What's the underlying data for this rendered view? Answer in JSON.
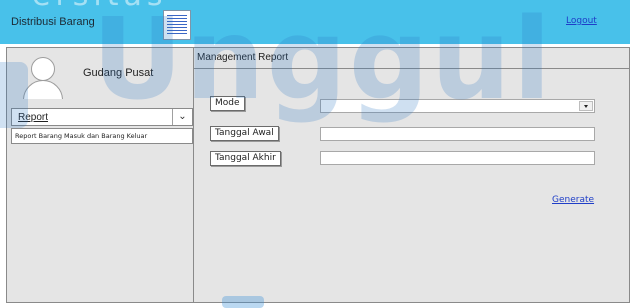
{
  "header": {
    "app_title": "Distribusi Barang",
    "logout_label": "Logout",
    "menu_icon": "document-icon",
    "background_color": "#48c1ea"
  },
  "sidebar": {
    "user_name": "Gudang Pusat",
    "avatar_icon": "user-avatar-icon",
    "report_dropdown": {
      "selected": "Report",
      "options": [
        "Report Barang Masuk dan Barang Keluar"
      ]
    }
  },
  "main": {
    "panel_title": "Management Report",
    "fields": {
      "mode": {
        "label": "Mode",
        "value": ""
      },
      "tanggal_awal": {
        "label": "Tanggal Awal",
        "value": ""
      },
      "tanggal_akhir": {
        "label": "Tanggal Akhir",
        "value": ""
      }
    },
    "generate_label": "Generate"
  },
  "watermark": {
    "main_text": "Unggul",
    "top_text": "ersitas"
  },
  "colors": {
    "link": "#1f3ec8",
    "panel_background": "#e5e5e5",
    "watermark": "#2a75c4"
  }
}
